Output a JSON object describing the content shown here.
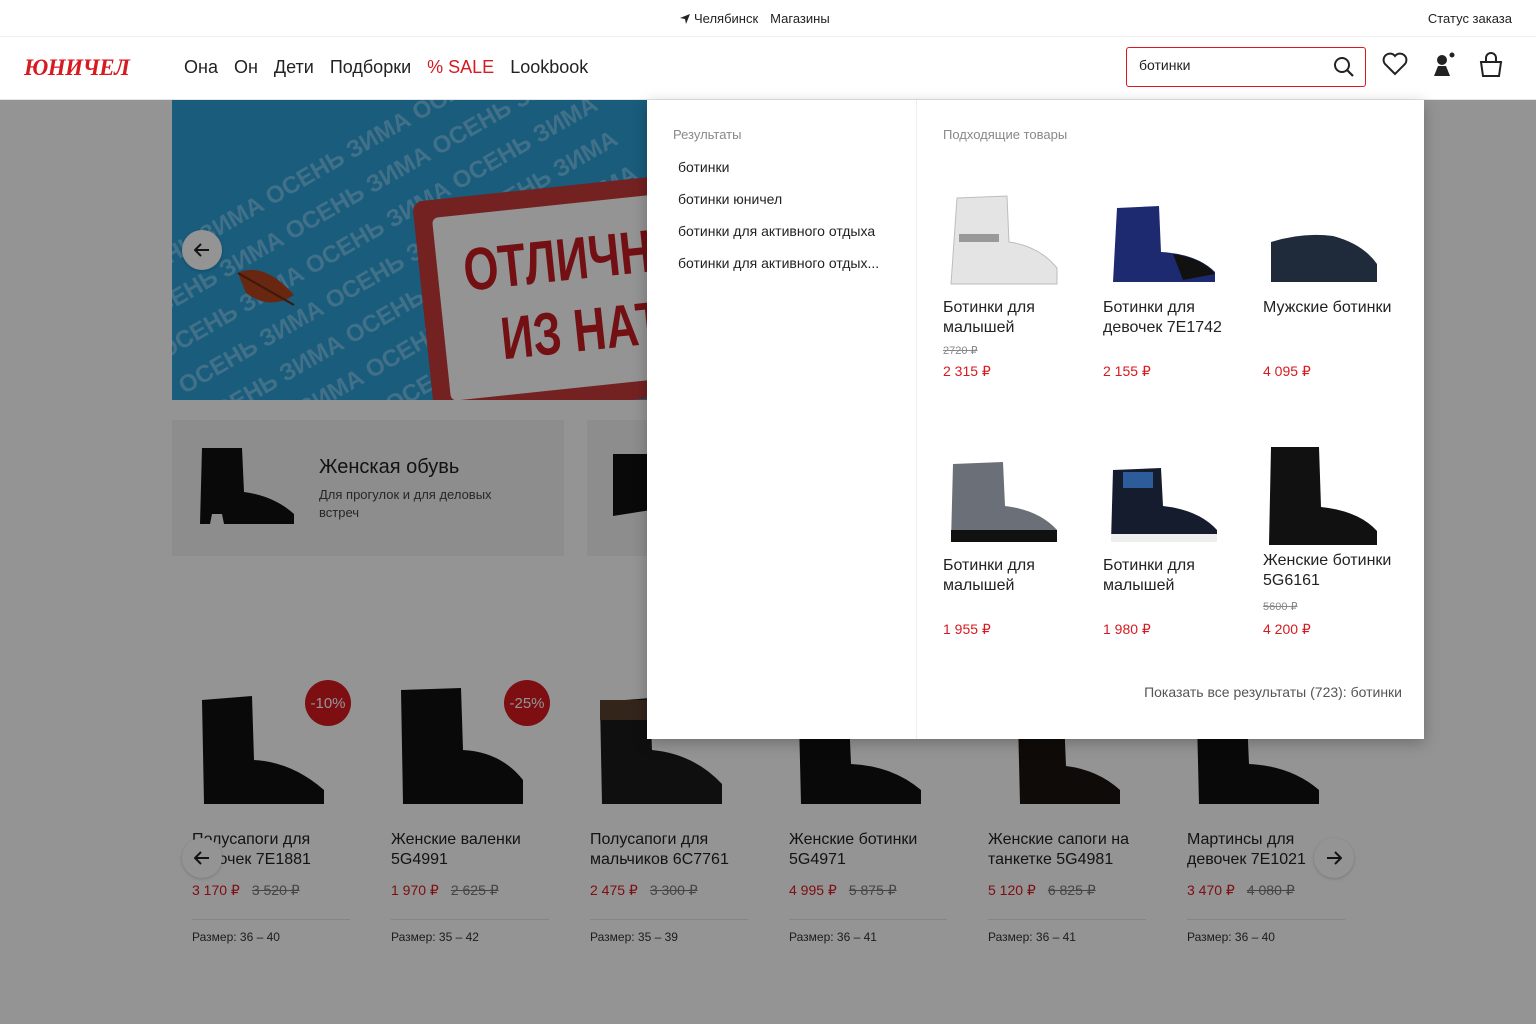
{
  "topbar": {
    "city": "Челябинск",
    "stores": "Магазины",
    "order_status": "Статус заказа"
  },
  "header": {
    "logo": "ЮНИЧЕЛ",
    "nav": [
      "Она",
      "Он",
      "Дети",
      "Подборки",
      "% SALE",
      "Lookbook"
    ],
    "search_value": "ботинки"
  },
  "banner": {
    "headline_line1": "ОТЛИЧНА",
    "headline_line2": "ИЗ НАТ",
    "pattern_text": "ОСЕНЬ ЗИМА ОСЕНЬ ЗИМА ОСЕНЬ ЗИМА"
  },
  "categories": [
    {
      "name": "Женская обувь",
      "desc": "Для прогулок и для деловых встреч"
    }
  ],
  "products": [
    {
      "title": "Полусапоги для девочек 7Е1881",
      "price": "3 170 ₽",
      "old": "3 520 ₽",
      "badge": "-10%",
      "size": "Размер: 36 – 40"
    },
    {
      "title": "Женские валенки 5G4991",
      "price": "1 970 ₽",
      "old": "2 625 ₽",
      "badge": "-25%",
      "size": "Размер: 35 – 42"
    },
    {
      "title": "Полусапоги для мальчиков 6С7761",
      "price": "2 475 ₽",
      "old": "3 300 ₽",
      "badge": "",
      "size": "Размер: 35 – 39"
    },
    {
      "title": "Женские ботинки 5G4971",
      "price": "4 995 ₽",
      "old": "5 875 ₽",
      "badge": "",
      "size": "Размер: 36 – 41"
    },
    {
      "title": "Женские сапоги на танкетке 5G4981",
      "price": "5 120 ₽",
      "old": "6 825 ₽",
      "badge": "",
      "size": "Размер: 36 – 41"
    },
    {
      "title": "Мартинсы для девочек 7Е1021",
      "price": "3 470 ₽",
      "old": "4 080 ₽",
      "badge": "",
      "size": "Размер: 36 – 40"
    }
  ],
  "dropdown": {
    "results_heading": "Результаты",
    "suggestions": [
      "ботинки",
      "ботинки юничел",
      "ботинки для активного отдыха",
      "ботинки для активного отдых..."
    ],
    "products_heading": "Подходящие товары",
    "items": [
      {
        "title": "Ботинки для малышей",
        "old": "2720 ₽",
        "price": "2 315 ₽"
      },
      {
        "title": "Ботинки для девочек 7Е1742",
        "old": "",
        "price": "2 155 ₽"
      },
      {
        "title": "Мужские ботинки",
        "old": "",
        "price": "4 095 ₽"
      },
      {
        "title": "Ботинки для малышей",
        "old": "",
        "price": "1 955 ₽"
      },
      {
        "title": "Ботинки для малышей",
        "old": "",
        "price": "1 980 ₽"
      },
      {
        "title": "Женские ботинки 5G6161",
        "old": "5600 ₽",
        "price": "4 200 ₽"
      }
    ],
    "show_all": "Показать все результаты (723): ботинки"
  },
  "colors": {
    "brand_red": "#d71920",
    "banner_blue": "#2b9fd6"
  },
  "icons": [
    "location-arrow-icon",
    "search-icon",
    "heart-icon",
    "user-icon",
    "bag-icon",
    "arrow-left-icon",
    "arrow-right-icon"
  ]
}
